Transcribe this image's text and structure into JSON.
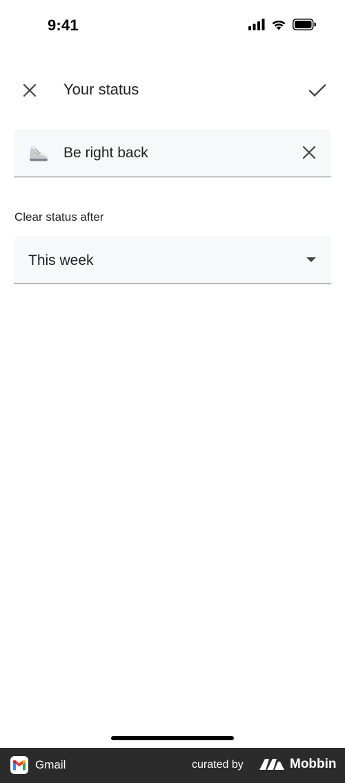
{
  "status_bar": {
    "time": "9:41",
    "icons": [
      "signal-icon",
      "wifi-icon",
      "battery-icon"
    ]
  },
  "header": {
    "title": "Your status",
    "close_icon": "close-icon",
    "confirm_icon": "checkmark-icon"
  },
  "status_input": {
    "emoji_icon": "running-shoe-icon",
    "value": "Be right back",
    "clear_icon": "close-icon"
  },
  "clear_after": {
    "label": "Clear status after",
    "selected": "This week"
  },
  "footer": {
    "app_name": "Gmail",
    "curated_by": "curated by",
    "brand": "Mobbin"
  },
  "colors": {
    "field_background": "#f7f8fa",
    "field_underline": "#5f6368",
    "footer_background": "#2b2b2b",
    "text": "#1f1f1f"
  }
}
